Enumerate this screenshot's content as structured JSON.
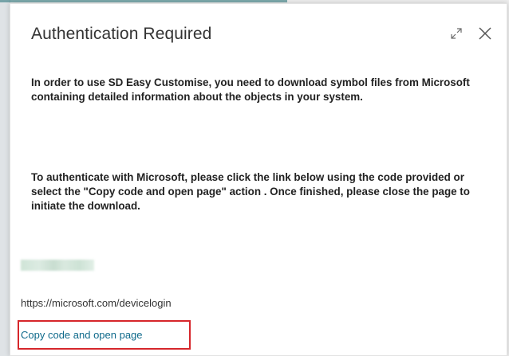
{
  "dialog": {
    "title": "Authentication Required",
    "paragraph1": "In order to use SD Easy Customise, you need to download symbol files from Microsoft containing detailed information about the objects in your system.",
    "paragraph2": "To authenticate with Microsoft, please click the link below using the code provided or select the \"Copy code and open page\" action . Once finished, please close the page to initiate the download.",
    "device_login_url": "https://microsoft.com/devicelogin",
    "copy_action_label": "Copy code and open page"
  },
  "colors": {
    "link": "#0f6a8b",
    "highlight_border": "#d6262b"
  },
  "icons": {
    "expand": "expand-icon",
    "close": "close-icon"
  }
}
